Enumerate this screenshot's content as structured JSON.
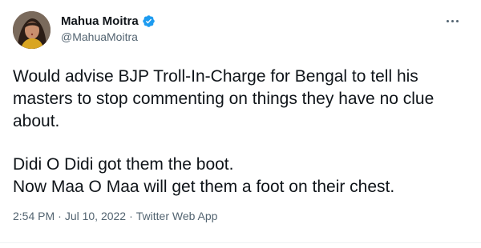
{
  "author": {
    "name": "Mahua Moitra",
    "handle": "@MahuaMoitra",
    "verified": true,
    "avatar_icon": "profile-photo",
    "verified_color": "#1d9bf0"
  },
  "tweet": {
    "paragraph1": "Would advise BJP Troll-In-Charge for Bengal to tell his masters to stop commenting on things they have no clue about.",
    "paragraph2_line1": "Didi O Didi got them the boot.",
    "paragraph2_line2": "Now Maa O Maa will get them a foot on their chest."
  },
  "meta": {
    "time": "2:54 PM",
    "separator": "·",
    "date": "Jul 10, 2022",
    "source": "Twitter Web App"
  },
  "icons": {
    "more": "more-horizontal-icon"
  }
}
